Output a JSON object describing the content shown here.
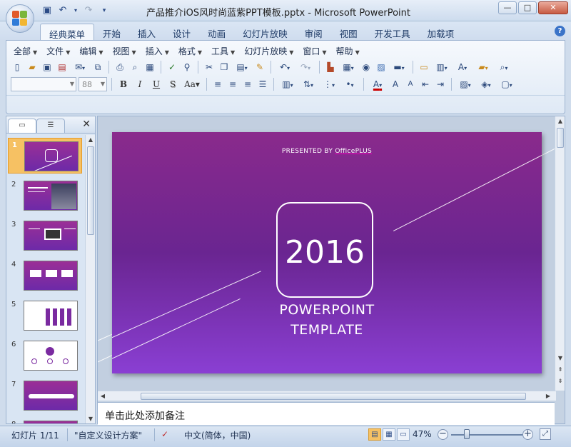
{
  "window": {
    "title": "产品推介iOS风时尚蓝紫PPT模板.pptx - Microsoft PowerPoint",
    "minimize": "—",
    "maximize": "□",
    "close": "✕"
  },
  "ribbon_tabs": [
    "经典菜单",
    "开始",
    "插入",
    "设计",
    "动画",
    "幻灯片放映",
    "审阅",
    "视图",
    "开发工具",
    "加载项"
  ],
  "active_tab": "经典菜单",
  "menus": [
    "全部",
    "文件",
    "编辑",
    "视图",
    "插入",
    "格式",
    "工具",
    "幻灯片放映",
    "窗口",
    "帮助"
  ],
  "font_size": "88",
  "font_name": "",
  "slides": [
    {
      "num": "1",
      "style": "title"
    },
    {
      "num": "2",
      "style": "photo"
    },
    {
      "num": "3",
      "style": "monitor"
    },
    {
      "num": "4",
      "style": "boxes"
    },
    {
      "num": "5",
      "style": "bars"
    },
    {
      "num": "6",
      "style": "circles"
    },
    {
      "num": "7",
      "style": "wave"
    },
    {
      "num": "8",
      "style": "title"
    }
  ],
  "selected_slide": "1",
  "slide": {
    "presented_by": "PRESENTED  BY",
    "brand": "OfficePLUS",
    "year": "2016",
    "title_line1": "POWERPOINT",
    "title_line2": "TEMPLATE"
  },
  "notes_placeholder": "单击此处添加备注",
  "status": {
    "slide_count": "幻灯片 1/11",
    "theme": "\"自定义设计方案\"",
    "language": "中文(简体，中国)",
    "zoom": "47%"
  },
  "colors": {
    "slide_top": "#8a2a8c",
    "slide_bottom": "#8a3fd3",
    "selection": "#f6c163"
  }
}
